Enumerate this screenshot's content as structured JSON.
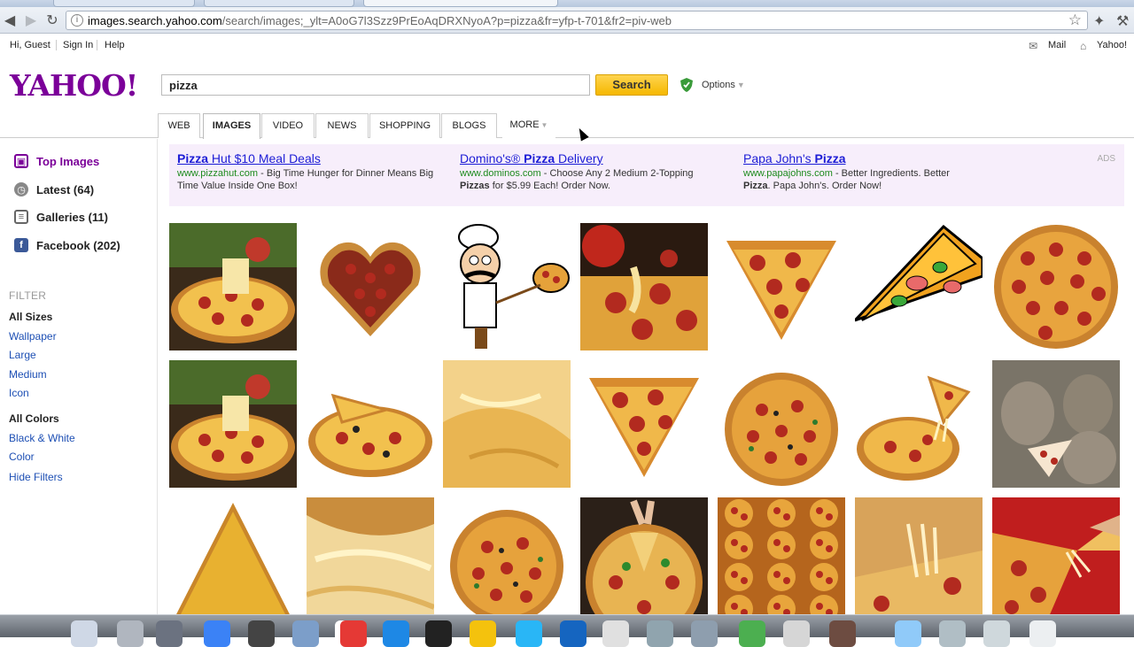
{
  "browser": {
    "url_host": "images.search.yahoo.com",
    "url_rest": "/search/images;_ylt=A0oG7l3Szz9PrEoAqDRXNyoA?p=pizza&fr=yfp-t-701&fr2=piv-web"
  },
  "util": {
    "greeting": "Hi, Guest",
    "sign_in": "Sign In",
    "help": "Help",
    "mail": "Mail",
    "yahoo": "Yahoo!"
  },
  "header": {
    "logo": "YAHOO!",
    "search_value": "pizza",
    "search_button": "Search",
    "options": "Options"
  },
  "tabs": [
    {
      "label": "WEB"
    },
    {
      "label": "IMAGES"
    },
    {
      "label": "VIDEO"
    },
    {
      "label": "NEWS"
    },
    {
      "label": "SHOPPING"
    },
    {
      "label": "BLOGS"
    },
    {
      "label": "MORE"
    }
  ],
  "sidebar": {
    "items": [
      {
        "label": "Top Images"
      },
      {
        "label": "Latest (64)"
      },
      {
        "label": "Galleries (11)"
      },
      {
        "label": "Facebook (202)"
      }
    ],
    "filter_heading": "FILTER",
    "sizes_heading": "All Sizes",
    "sizes": [
      "Wallpaper",
      "Large",
      "Medium",
      "Icon"
    ],
    "colors_heading": "All Colors",
    "colors": [
      "Black & White",
      "Color"
    ],
    "hide_filters": "Hide Filters"
  },
  "ads": {
    "label": "ADS",
    "items": [
      {
        "title_bold": "Pizza",
        "title_rest": " Hut $10 Meal Deals",
        "url": "www.pizzahut.com",
        "desc": " - Big Time Hunger for Dinner Means Big Time Value Inside One Box!"
      },
      {
        "title_pre": "Domino's® ",
        "title_bold": "Pizza",
        "title_rest": " Delivery",
        "url": "www.dominos.com",
        "desc_pre": " - Choose Any 2 Medium 2-Topping ",
        "desc_bold": "Pizzas",
        "desc_rest": " for $5.99 Each! Order Now."
      },
      {
        "title_pre": "Papa John's ",
        "title_bold": "Pizza",
        "url": "www.papajohns.com",
        "desc_pre": " - Better Ingredients. Better ",
        "desc_bold": "Pizza",
        "desc_rest": ". Papa John's. Order Now!"
      }
    ]
  },
  "images": [
    "pizza-cheese-pull",
    "heart-pizza",
    "pizza-chef-cartoon",
    "pepperoni-tomato-pizza",
    "pepperoni-slice",
    "cartoon-slice",
    "whole-pepperoni-pizza",
    "pizza-cheese-pull",
    "supreme-pizza-slice-pull",
    "cheese-pizza-closeup",
    "pepperoni-slice",
    "supreme-pizza",
    "pizza-slice-lift",
    "squirrels-eating-pizza",
    "cheese-slice",
    "cheese-closeup",
    "supreme-pizza",
    "hand-lifting-slice",
    "pizza-collage",
    "cheese-pull-closeup",
    "hand-pulling-slice"
  ],
  "colors": {
    "yahoo_purple": "#7b0099",
    "link_blue": "#1d4fb4",
    "ad_url_green": "#1d8a1d",
    "search_button_yellow": "#f5b800",
    "ad_background": "#f7eefb"
  }
}
